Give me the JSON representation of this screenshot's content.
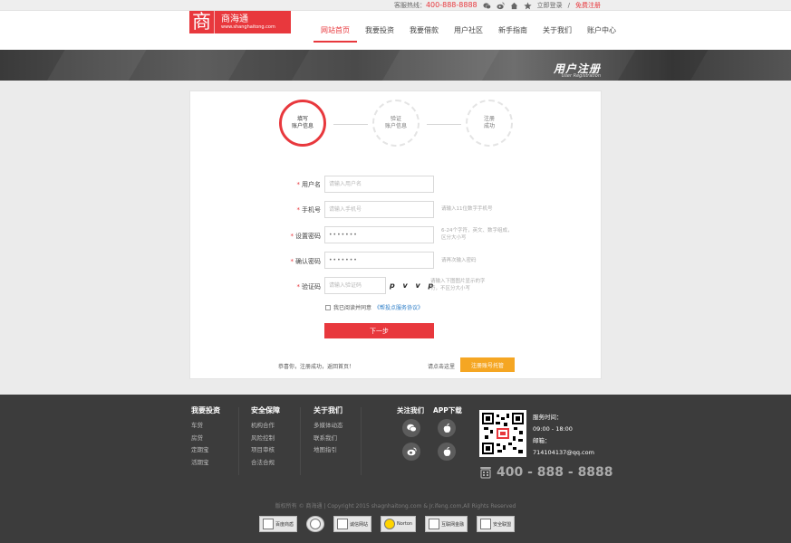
{
  "topbar": {
    "hotline_label": "客服热线：",
    "hotline_number": "400-888-8888",
    "login": "立即登录",
    "separator": "/",
    "register": "免费注册"
  },
  "logo": {
    "glyph": "商",
    "name": "商海通",
    "domain": "www.shanghaitong.com"
  },
  "nav": {
    "items": [
      "网站首页",
      "我要投资",
      "我要借款",
      "用户社区",
      "新手指南",
      "关于我们",
      "账户中心"
    ],
    "active_index": 0
  },
  "banner": {
    "title": "用户注册",
    "subtitle": "User Registration"
  },
  "steps": [
    {
      "line1": "填写",
      "line2": "账户信息"
    },
    {
      "line1": "验证",
      "line2": "账户信息"
    },
    {
      "line1": "注册",
      "line2": "成功"
    }
  ],
  "form": {
    "fields": [
      {
        "label": "用户名",
        "placeholder": "请输入用户名",
        "hint": ""
      },
      {
        "label": "手机号",
        "placeholder": "请输入手机号",
        "hint": "请输入11位数字手机号"
      },
      {
        "label": "设置密码",
        "value": "•••••••",
        "hint": "6-24个字符，英文、数字组成，区分大小写"
      },
      {
        "label": "确认密码",
        "value": "•••••••",
        "hint": "请再次输入密码"
      },
      {
        "label": "验证码",
        "placeholder": "请输入验证码",
        "hint": "请输入下图图片显示的字符，不区分大小写"
      }
    ],
    "required_mark": "*",
    "captcha_text": "p v v p",
    "agree_text": "我已阅读并同意",
    "agree_link": "《帮投点服务协议》",
    "next_button": "下一步"
  },
  "card_bottom": {
    "left_text": "恭喜你，注册成功，返回首页！",
    "right_text": "请点击这里",
    "host_button": "注册账号托管"
  },
  "footer": {
    "columns": [
      {
        "title": "我要投资",
        "links": [
          "车贷",
          "房贷",
          "定期宝",
          "活期宝"
        ]
      },
      {
        "title": "安全保障",
        "links": [
          "机构合作",
          "风险控制",
          "项目审核",
          "合法合规"
        ]
      },
      {
        "title": "关于我们",
        "links": [
          "多媒体动态",
          "联系我们",
          "地图指引"
        ]
      }
    ],
    "follow_title": "关注我们",
    "app_title": "APP下载",
    "service_time_label": "服务时间：",
    "service_time": "09:00 - 18:00",
    "email_label": "邮箱：",
    "email": "714104137@qq.com",
    "phone": "400 - 888 - 8888",
    "copyright": "版权所有 © 商海通   |   Copyright 2015 shagnhaitong.com & Jr.ifeng.com,All Rights Reserved",
    "badges": [
      "百度商盾",
      "",
      "诚信网站",
      "Norton",
      "互联网金融",
      "安全联盟"
    ]
  },
  "icons": {
    "topbar": [
      "wechat-icon",
      "weibo-icon",
      "home-icon",
      "star-icon"
    ],
    "social": [
      "wechat-icon",
      "apple-icon",
      "weibo-icon",
      "apple-icon"
    ],
    "phone": "phone-icon"
  },
  "colors": {
    "brand_red": "#e8383d",
    "accent_orange": "#f5a623",
    "footer_bg": "#3c3c3c"
  }
}
